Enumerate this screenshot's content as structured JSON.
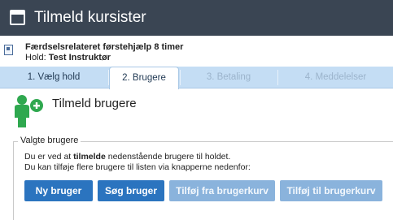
{
  "window": {
    "title": "Tilmeld kursister"
  },
  "course": {
    "name": "Færdselsrelateret førstehjælp 8 timer",
    "hold_label": "Hold:",
    "hold_value": "Test Instruktør"
  },
  "tabs": [
    {
      "label": "1. Vælg hold",
      "state": "done"
    },
    {
      "label": "2. Brugere",
      "state": "active"
    },
    {
      "label": "3. Betaling",
      "state": "disabled"
    },
    {
      "label": "4. Meddelelser",
      "state": "disabled"
    }
  ],
  "page": {
    "title": "Tilmeld brugere"
  },
  "selected": {
    "legend": "Valgte brugere",
    "info_pre": "Du er ved at ",
    "info_bold": "tilmelde",
    "info_post": " nedenstående brugere til holdet.",
    "info2": "Du kan tilføje flere brugere til listen via knapperne nedenfor:"
  },
  "buttons": {
    "new_user": "Ny bruger",
    "search_user": "Søg bruger",
    "add_from_basket": "Tilføj fra brugerkurv",
    "add_to_basket": "Tilføj til brugerkurv"
  },
  "colors": {
    "titlebar": "#3a4553",
    "tabbar": "#c4ddf4",
    "primary_button": "#2b74bf",
    "disabled_button": "#8ab3dc",
    "user_icon": "#2fa84f"
  }
}
